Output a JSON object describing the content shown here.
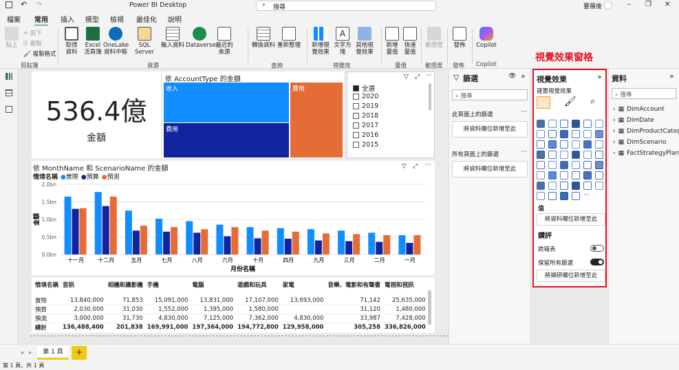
{
  "app": {
    "title": "Power BI Desktop",
    "search": "搜尋",
    "user": "要展後"
  },
  "menu": [
    "檔案",
    "常用",
    "插入",
    "模型",
    "檢視",
    "最佳化",
    "說明"
  ],
  "ribbon": {
    "clipboard": {
      "paste": "貼上",
      "cut": "剪下",
      "copy": "複製",
      "format": "複製格式",
      "group": "剪貼簿"
    },
    "data": [
      {
        "l1": "取得",
        "l2": "資料"
      },
      {
        "l1": "Excel",
        "l2": "活頁簿"
      },
      {
        "l1": "OneLake",
        "l2": "資料中樞"
      },
      {
        "l1": "SQL Server",
        "l2": ""
      },
      {
        "l1": "輸入資料",
        "l2": ""
      },
      {
        "l1": "Dataverse",
        "l2": ""
      },
      {
        "l1": "最近的",
        "l2": "來源"
      }
    ],
    "data_group": "資源",
    "query": [
      {
        "l1": "轉換資料",
        "l2": ""
      },
      {
        "l1": "重新整理",
        "l2": ""
      }
    ],
    "query_group": "查詢",
    "insert": [
      {
        "l1": "新增視",
        "l2": "覺效果"
      },
      {
        "l1": "文字方",
        "l2": "塊"
      },
      {
        "l1": "其他視",
        "l2": "覺效果"
      }
    ],
    "insert_group": "視覺效",
    "calc": [
      {
        "l1": "新增",
        "l2": "量值"
      },
      {
        "l1": "快速",
        "l2": "量值"
      }
    ],
    "calc_group": "量值",
    "sens": {
      "l1": "敏感度",
      "group": "敏感度"
    },
    "publish": {
      "l1": "發佈",
      "group": "發佈"
    },
    "copilot": {
      "l1": "Copilot",
      "group": "Copilot"
    }
  },
  "card": {
    "value": "536.4億",
    "label": "金額"
  },
  "treemap": {
    "title": "依 AccountType 的金額",
    "items": [
      "收入",
      "費用",
      "費用"
    ]
  },
  "slicer": {
    "items": [
      {
        "label": "全選",
        "checked": true
      },
      {
        "label": "2020"
      },
      {
        "label": "2019"
      },
      {
        "label": "2018"
      },
      {
        "label": "2017"
      },
      {
        "label": "2016"
      },
      {
        "label": "2015"
      }
    ]
  },
  "chart_data": {
    "type": "bar",
    "title": "依 MonthName 和 ScenarioName 的金額",
    "legend_title": "情境名稱",
    "xlabel": "月份名稱",
    "ylabel": "金額",
    "yticks": [
      "2.0bn",
      "1.5bn",
      "1.0bn",
      "0.5bn",
      "0.0bn"
    ],
    "ylim": [
      0,
      2.0
    ],
    "categories": [
      "十一月",
      "十二月",
      "五月",
      "七月",
      "八月",
      "六月",
      "十月",
      "四月",
      "九月",
      "三月",
      "二月",
      "一月"
    ],
    "series": [
      {
        "name": "實際",
        "color": "#118dff",
        "values": [
          1.65,
          1.78,
          1.25,
          1.02,
          0.95,
          0.85,
          0.78,
          0.75,
          0.72,
          0.68,
          0.62,
          0.55
        ]
      },
      {
        "name": "預算",
        "color": "#12239e",
        "values": [
          1.3,
          1.38,
          0.68,
          0.65,
          0.62,
          0.52,
          0.46,
          0.45,
          0.4,
          0.38,
          0.36,
          0.33
        ]
      },
      {
        "name": "預測",
        "color": "#e66c37",
        "values": [
          1.32,
          1.65,
          0.82,
          0.78,
          0.72,
          0.78,
          0.68,
          0.65,
          0.6,
          0.58,
          0.55,
          0.55
        ]
      }
    ]
  },
  "table": {
    "headers": [
      "情境名稱",
      "音訊",
      "相機和攝影機",
      "手機",
      "電腦",
      "遊戲和玩具",
      "家電",
      "音樂、電影和有聲書",
      "電視和視訊"
    ],
    "rows": [
      [
        "實際",
        "13,840,000",
        "71,853",
        "15,091,000",
        "13,831,000",
        "17,107,000",
        "13,693,000",
        "71,142",
        "25,635,000"
      ],
      [
        "預算",
        "2,030,000",
        "31,030",
        "1,552,000",
        "1,395,000",
        "1,580,000",
        "",
        "31,120",
        "1,480,000"
      ],
      [
        "預測",
        "3,000,000",
        "31,730",
        "4,830,000",
        "7,125,000",
        "7,362,000",
        "4,830,000",
        "33,987",
        "7,428,000"
      ],
      [
        "總計",
        "136,488,400",
        "201,838",
        "169,991,000",
        "197,364,000",
        "194,772,800",
        "129,958,000",
        "305,258",
        "336,826,000"
      ]
    ]
  },
  "filters": {
    "title": "篩選",
    "search": "搜尋",
    "this_page": "此頁面上的篩選",
    "all_pages": "所有頁面上的篩選",
    "add": "將資料欄位新增至此"
  },
  "viz": {
    "annotation": "視覺效果窗格",
    "title": "視覺效果",
    "build": "建置視覺效果",
    "values": "值",
    "add": "將資料欄位新增至此",
    "drill": "鑽評",
    "cross": "跨報表",
    "keep": "保留所有篩選",
    "drill_add": "將擷研欄位新增至此",
    "toggle_off": "關",
    "toggle_on": "開",
    "more": "···"
  },
  "data_pane": {
    "title": "資料",
    "search": "搜尋",
    "tables": [
      "DimAccount",
      "DimDate",
      "DimProductCategory",
      "DimScenario",
      "FactStrategyPlan"
    ]
  },
  "page": {
    "tab": "第 1 頁",
    "add": "+"
  },
  "status": "第 1 頁，共 1 頁"
}
